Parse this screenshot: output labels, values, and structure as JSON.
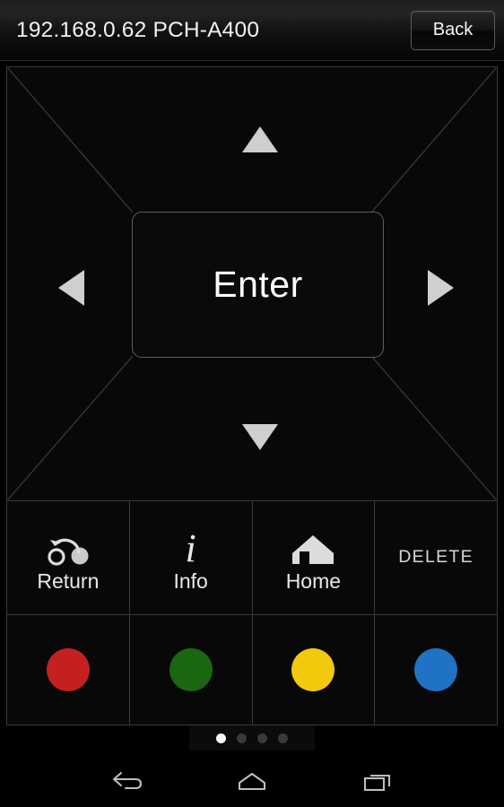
{
  "titlebar": {
    "title": "192.168.0.62 PCH-A400",
    "back_label": "Back"
  },
  "dpad": {
    "enter_label": "Enter",
    "up_icon": "triangle-up-icon",
    "down_icon": "triangle-down-icon",
    "left_icon": "triangle-left-icon",
    "right_icon": "triangle-right-icon",
    "arrow_color": "#cfcfcf"
  },
  "function_keys": [
    {
      "label": "Return",
      "icon": "return-arrow-icon"
    },
    {
      "label": "Info",
      "icon": "info-italic-i-icon"
    },
    {
      "label": "Home",
      "icon": "home-house-icon"
    },
    {
      "label": "DELETE",
      "icon": ""
    }
  ],
  "color_keys": [
    {
      "name": "red",
      "color": "#c4201f",
      "icon": "red-circle-icon"
    },
    {
      "name": "green",
      "color": "#1a6611",
      "icon": "green-circle-icon"
    },
    {
      "name": "yellow",
      "color": "#f2c90d",
      "icon": "yellow-circle-icon"
    },
    {
      "name": "blue",
      "color": "#1f72c4",
      "icon": "blue-circle-icon"
    }
  ],
  "pager": {
    "total": 4,
    "active_index": 0
  },
  "navbar": {
    "back": "android-back-icon",
    "home": "android-home-icon",
    "recents": "android-recents-icon"
  }
}
